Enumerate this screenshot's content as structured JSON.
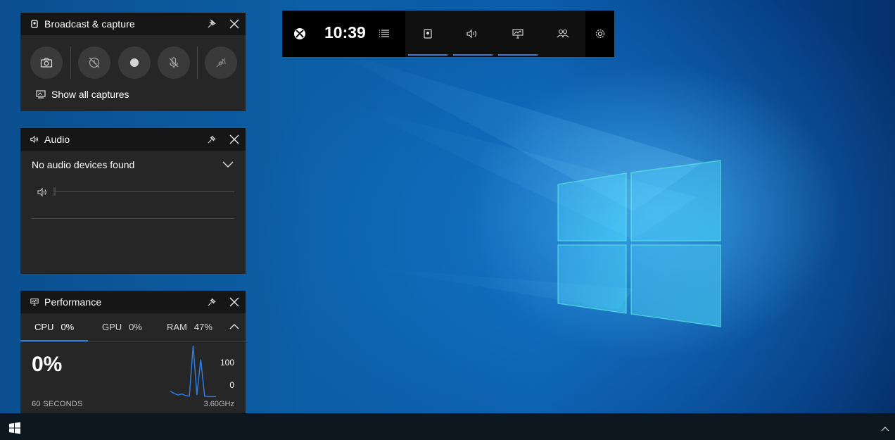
{
  "broadcast": {
    "title": "Broadcast & capture",
    "show_all_captures": "Show all captures"
  },
  "audio": {
    "title": "Audio",
    "device": "No audio devices found",
    "volume_level": 0
  },
  "performance": {
    "title": "Performance",
    "tabs": [
      {
        "label": "CPU",
        "value": "0%"
      },
      {
        "label": "GPU",
        "value": "0%"
      },
      {
        "label": "RAM",
        "value": "47%"
      }
    ],
    "big_value": "0%",
    "scale_max": "100",
    "scale_min": "0",
    "window": "60 SECONDS",
    "frequency": "3.60GHz",
    "history": [
      12,
      8,
      5,
      7,
      4,
      3,
      95,
      5,
      70,
      3,
      2,
      2,
      2
    ]
  },
  "gamebar": {
    "clock": "10:39"
  },
  "colors": {
    "accent": "#2b7de0",
    "panel_bg": "#262626",
    "panel_header": "#161616"
  }
}
